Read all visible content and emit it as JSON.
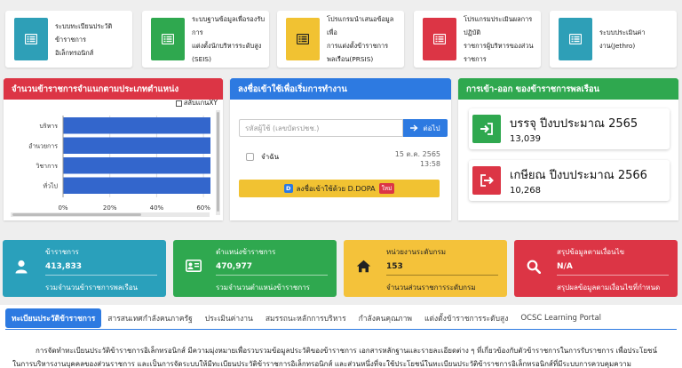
{
  "shortcuts": [
    {
      "line1": "ระบบทะเบียนประวัติข้าราชการ",
      "line2": "อิเล็กทรอนิกส์",
      "line3": "",
      "color": "#2e9fb7"
    },
    {
      "line1": "ระบบฐานข้อมูลเพื่อรองรับการ",
      "line2": "แต่งตั้งนักบริหารระดับสูง",
      "line3": "(SEIS)",
      "color": "#2fa84f"
    },
    {
      "line1": "โปรแกรมนำเสนอข้อมูลเพื่อ",
      "line2": "การแต่งตั้งข้าราชการ",
      "line3": "พลเรือน(PRSIS)",
      "color": "#f1c232"
    },
    {
      "line1": "โปรแกรมประเมินผลการปฏิบัติ",
      "line2": "ราชการผู้บริหารของส่วน",
      "line3": "ราชการ",
      "color": "#dc3545"
    },
    {
      "line1": "ระบบประเมินค่างาน(Jethro)",
      "line2": "",
      "line3": "",
      "color": "#2e9fb7"
    }
  ],
  "chart_panel": {
    "title": "จำนวนข้าราชการจำแนกตามประเภทตำแหน่ง",
    "color": "#dc3545",
    "toggle_label": "สลับแกนXY"
  },
  "chart_data": {
    "type": "bar",
    "orientation": "horizontal",
    "categories": [
      "บริหาร",
      "อำนวยการ",
      "วิชาการ",
      "ทั่วไป"
    ],
    "values": [
      63,
      63,
      63,
      63
    ],
    "x_tick_labels": [
      "0%",
      "20%",
      "40%",
      "60%"
    ],
    "xlim": [
      0,
      63
    ],
    "bar_color": "#3366cc"
  },
  "login": {
    "title": "ลงชื่อเข้าใช้เพื่อเริ่มการทำงาน",
    "color": "#2d7ae1",
    "placeholder": "รหัสผู้ใช้ (เลขบัตรปชช.)",
    "next_label": "ต่อไป",
    "remember_label": "จำฉัน",
    "date": "15 ต.ค. 2565",
    "time": "13:58",
    "dopa_badge": "D",
    "dopa_label": "ลงชื่อเข้าใช้ด้วย D.DOPA",
    "new_badge": "ใหม่"
  },
  "movement": {
    "title": "การเข้า-ออก ของข้าราชการพลเรือน",
    "color": "#2fa84f",
    "items": [
      {
        "title": "บรรจุ ปีงบประมาณ 2565",
        "number": "13,039",
        "color": "#2fa84f"
      },
      {
        "title": "เกษียณ ปีงบประมาณ 2566",
        "number": "10,268",
        "color": "#dc3545"
      }
    ]
  },
  "info_boxes": [
    {
      "label": "ข้าราชการ",
      "value": "413,833",
      "desc": "รวมจำนวนข้าราชการพลเรือน",
      "color": "#2aa0bb",
      "text_color": "#ffffff"
    },
    {
      "label": "ตำแหน่งข้าราชการ",
      "value": "470,977",
      "desc": "รวมจำนวนตำแหน่งข้าราชการ",
      "color": "#2fa84f",
      "text_color": "#ffffff"
    },
    {
      "label": "หน่วยงานระดับกรม",
      "value": "153",
      "desc": "จำนวนส่วนราชการระดับกรม",
      "color": "#f4c23a",
      "text_color": "#222222"
    },
    {
      "label": "สรุปข้อมูลตามเงื่อนไข",
      "value": "N/A",
      "desc": "สรุปผลข้อมูลตามเงื่อนไขที่กำหนด",
      "color": "#dc3545",
      "text_color": "#ffffff"
    }
  ],
  "tabs": [
    "ทะเบียนประวัติข้าราชการ",
    "สารสนเทศกำลังคนภาครัฐ",
    "ประเมินค่างาน",
    "สมรรถนะหลักการบริหาร",
    "กำลังคนคุณภาพ",
    "แต่งตั้งข้าราชการระดับสูง",
    "OCSC Learning Portal"
  ],
  "description": {
    "line1": "การจัดทำทะเบียนประวัติข้าราชการอิเล็กทรอนิกส์ มีความมุ่งหมายเพื่อรวบรวมข้อมูลประวัติของข้าราชการ เอกสารหลักฐานและรายละเอียดต่าง ๆ ที่เกี่ยวข้องกับตัวข้าราชการในการรับราชการ เพื่อประโยชน์",
    "line2": "ในการบริหารงานบุคคลของส่วนราชการ และเป็นการจัดระบบให้มีทะเบียนประวัติข้าราชการอิเล็กทรอนิกส์ และส่วนหนึ่งที่จะใช้ประโยชน์ในทะเบียนประวัติข้าราชการอิเล็กทรอนิกส์ที่มีระบบการควบคุมความ"
  }
}
